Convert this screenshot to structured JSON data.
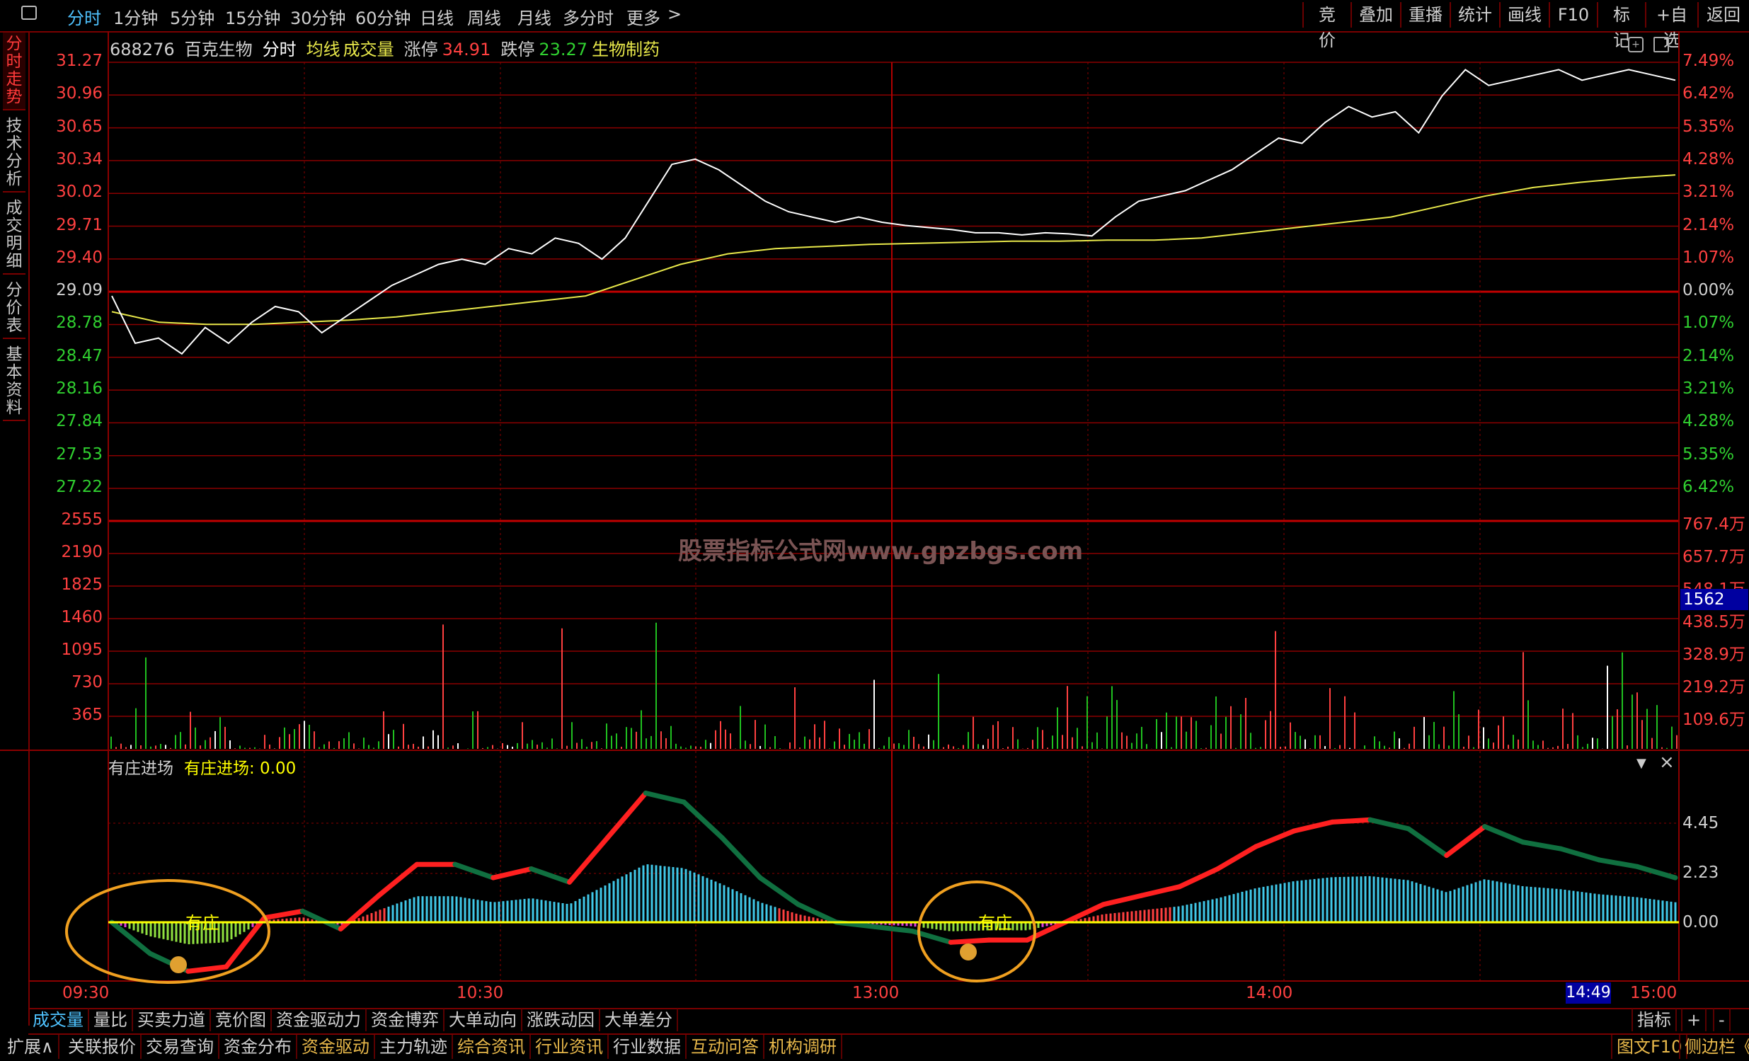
{
  "topbar": {
    "icon": "window-icon",
    "periods": [
      "分时",
      "1分钟",
      "5分钟",
      "15分钟",
      "30分钟",
      "60分钟",
      "日线",
      "周线",
      "月线",
      "多分时",
      "更多"
    ],
    "active_period": "分时",
    "more_arrow": ">",
    "right_buttons": [
      "竞价",
      "叠加",
      "重播",
      "统计",
      "画线",
      "F10",
      "标记",
      "+自选",
      "返回"
    ]
  },
  "left_tabs": [
    "分时走势",
    "技术分析",
    "成交明细",
    "分价表",
    "基本资料"
  ],
  "info": {
    "code": "688276",
    "name": "百克生物",
    "mode": "分时",
    "avg_label": "均线",
    "vol_label": "成交量",
    "limit_up_label": "涨停",
    "limit_up": "34.91",
    "limit_down_label": "跌停",
    "limit_down": "23.27",
    "sector": "生物制药"
  },
  "price_axis_left": [
    "31.27",
    "30.96",
    "30.65",
    "30.34",
    "30.02",
    "29.71",
    "29.40",
    "29.09",
    "28.78",
    "28.47",
    "28.16",
    "27.84",
    "27.53",
    "27.22"
  ],
  "price_axis_right": [
    "7.49%",
    "6.42%",
    "5.35%",
    "4.28%",
    "3.21%",
    "2.14%",
    "1.07%",
    "0.00%",
    "1.07%",
    "2.14%",
    "3.21%",
    "4.28%",
    "5.35%",
    "6.42%"
  ],
  "volume_axis_left": [
    "2555",
    "2190",
    "1825",
    "1460",
    "1095",
    "730",
    "365"
  ],
  "volume_axis_right": [
    "767.4万",
    "657.7万",
    "548.1万",
    "438.5万",
    "328.9万",
    "219.2万",
    "109.6万"
  ],
  "volume_cursor_value": "1562",
  "watermark": "股票指标公式网www.gpzbgs.com",
  "indicator": {
    "name": "有庄进场",
    "value_label": "有庄进场: 0.00",
    "axis": [
      "4.45",
      "2.23",
      "0.00"
    ],
    "signal_label": "有庄",
    "dropdown_icon": "▼",
    "close_icon": "×"
  },
  "time_axis": [
    "09:30",
    "10:30",
    "13:00",
    "14:00",
    "15:00"
  ],
  "time_cursor": "14:49",
  "bottom_tabs": [
    "成交量",
    "量比",
    "买卖力道",
    "竞价图",
    "资金驱动力",
    "资金博弈",
    "大单动向",
    "涨跌动因",
    "大单差分"
  ],
  "bottom_tabs_active": "成交量",
  "bottom_right": [
    "指标",
    "+",
    "-"
  ],
  "status_bar": [
    "扩展∧",
    "关联报价",
    "交易查询",
    "资金分布",
    "资金驱动",
    "主力轨迹",
    "综合资讯",
    "行业资讯",
    "行业数据",
    "互动问答",
    "机构调研"
  ],
  "status_bar_highlight": [
    "资金驱动",
    "综合资讯",
    "行业资讯",
    "互动问答",
    "机构调研"
  ],
  "status_right": [
    "图文F10",
    "侧边栏《"
  ],
  "chart_data": {
    "type": "line",
    "prev_close": 29.09,
    "price_series": {
      "name": "价格",
      "color": "#ffffff",
      "values": [
        29.05,
        28.6,
        28.65,
        28.5,
        28.75,
        28.6,
        28.8,
        28.95,
        28.9,
        28.7,
        28.85,
        29.0,
        29.15,
        29.25,
        29.35,
        29.4,
        29.35,
        29.5,
        29.45,
        29.6,
        29.55,
        29.4,
        29.6,
        29.95,
        30.3,
        30.35,
        30.25,
        30.1,
        29.95,
        29.85,
        29.8,
        29.75,
        29.8,
        29.75,
        29.72,
        29.7,
        29.68,
        29.65,
        29.65,
        29.63,
        29.65,
        29.64,
        29.62,
        29.8,
        29.95,
        30.0,
        30.05,
        30.15,
        30.25,
        30.4,
        30.55,
        30.5,
        30.7,
        30.85,
        30.75,
        30.8,
        30.6,
        30.95,
        31.2,
        31.05,
        31.1,
        31.15,
        31.2,
        31.1,
        31.15,
        31.2,
        31.15,
        31.1
      ]
    },
    "avg_series": {
      "name": "均线",
      "color": "#e8e84a",
      "values": [
        28.9,
        28.8,
        28.78,
        28.78,
        28.8,
        28.82,
        28.85,
        28.9,
        28.95,
        29.0,
        29.05,
        29.2,
        29.35,
        29.45,
        29.5,
        29.52,
        29.54,
        29.55,
        29.56,
        29.57,
        29.57,
        29.58,
        29.58,
        29.6,
        29.65,
        29.7,
        29.75,
        29.8,
        29.9,
        30.0,
        30.08,
        30.13,
        30.17,
        30.2
      ]
    },
    "volume_max": 2555,
    "indicator_series": {
      "name": "有庄进场",
      "values": [
        0,
        -1.4,
        -2.2,
        -2.0,
        0.2,
        0.5,
        -0.3,
        1.2,
        2.6,
        2.6,
        2.0,
        2.4,
        1.8,
        3.8,
        5.8,
        5.4,
        3.8,
        2.0,
        0.8,
        0.0,
        -0.2,
        -0.4,
        -0.9,
        -0.8,
        -0.8,
        0.0,
        0.8,
        1.2,
        1.6,
        2.4,
        3.4,
        4.1,
        4.5,
        4.6,
        4.2,
        3.0,
        4.3,
        3.6,
        3.3,
        2.8,
        2.5,
        2.0
      ]
    }
  }
}
